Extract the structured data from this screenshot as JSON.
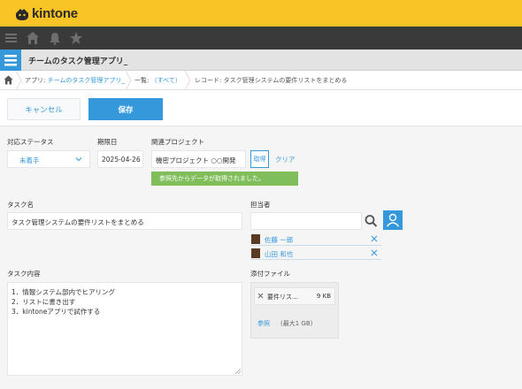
{
  "header": {
    "logo_text": "kintone"
  },
  "nav": {
    "icons": [
      "menu-icon",
      "home-icon",
      "bell-icon",
      "star-icon"
    ]
  },
  "app": {
    "title": "チームのタスク管理アプリ_"
  },
  "breadcrumb": {
    "app_prefix": "アプリ: ",
    "app_name": "チームのタスク管理アプリ_",
    "view_prefix": "一覧: ",
    "view_name": "（すべて）",
    "record_text": "レコード: タスク管理システムの要件リストをまとめる"
  },
  "actions": {
    "cancel_label": "キャンセル",
    "save_label": "保存"
  },
  "fields": {
    "status": {
      "label": "対応ステータス",
      "value": "未着手"
    },
    "due": {
      "label": "期限日",
      "value": "2025-04-26"
    },
    "project": {
      "label": "関連プロジェクト",
      "value": "機密プロジェクト ○○開発",
      "fetch_label": "取得",
      "clear_label": "クリア",
      "notice": "参照先からデータが取得されました。"
    },
    "task_name": {
      "label": "タスク名",
      "value": "タスク管理システムの要件リストをまとめる"
    },
    "assignee": {
      "label": "担当者",
      "search_value": "",
      "members": [
        {
          "name": "佐藤 一郎"
        },
        {
          "name": "山田 和也"
        }
      ]
    },
    "task_content": {
      "label": "タスク内容",
      "lines": [
        "1．情報システム部内でヒアリング",
        "2．リストに書き出す",
        "3．kintoneアプリで試作する"
      ]
    },
    "attachment": {
      "label": "添付ファイル",
      "file_name": "要件リス…",
      "file_size": "9 KB",
      "browse_label": "参照",
      "max_size": "(最大1 GB)"
    }
  },
  "colors": {
    "brand_yellow": "#f9c425",
    "accent_blue": "#3498db",
    "nav_dark": "#3a3a3a",
    "notice_green": "#7fbe5a"
  }
}
